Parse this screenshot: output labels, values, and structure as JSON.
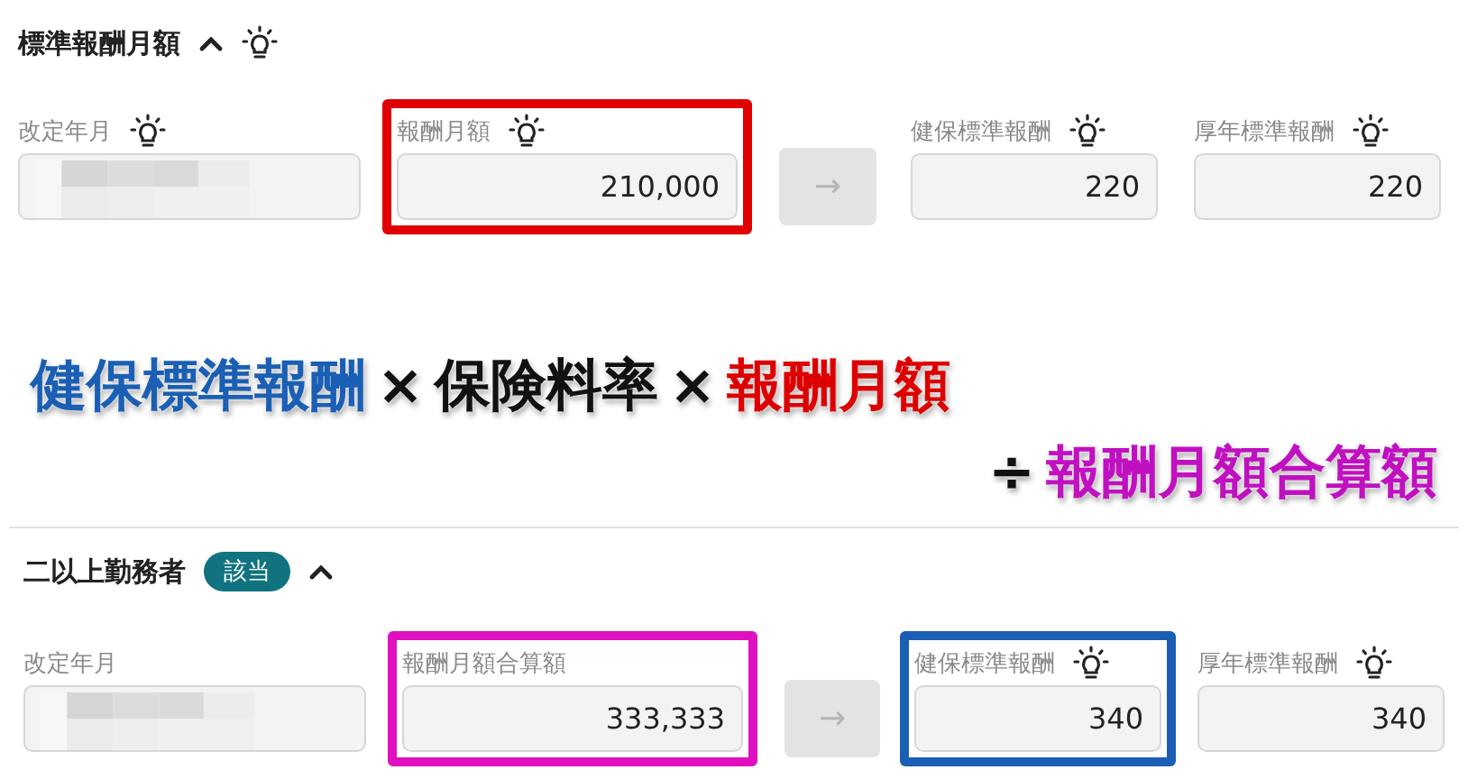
{
  "sections": [
    {
      "title": "標準報酬月額",
      "expanded": true,
      "hint": true,
      "convert_button": "→",
      "fields": [
        {
          "kind": "redacted",
          "label": "改定年月",
          "hint": true
        },
        {
          "kind": "value",
          "label": "報酬月額",
          "hint": true,
          "value": "210,000",
          "color": "#e00000"
        },
        {
          "kind": "value",
          "label": "健保標準報酬",
          "hint": true,
          "value": "220"
        },
        {
          "kind": "value",
          "label": "厚年標準報酬",
          "hint": true,
          "value": "220"
        }
      ]
    },
    {
      "title": "二以上勤務者",
      "badge": "該当",
      "expanded": true,
      "hint": false,
      "convert_button": "→",
      "fields": [
        {
          "kind": "redacted",
          "label": "改定年月",
          "hint": false
        },
        {
          "kind": "value",
          "label": "報酬月額合算額",
          "hint": false,
          "value": "333,333",
          "color": "#e010c0"
        },
        {
          "kind": "value",
          "label": "健保標準報酬",
          "hint": true,
          "value": "340",
          "color": "#1a5fb4"
        },
        {
          "kind": "value",
          "label": "厚年標準報酬",
          "hint": true,
          "value": "340"
        }
      ]
    }
  ],
  "formula": {
    "lines": [
      {
        "parts": [
          {
            "text": "健保標準報酬",
            "color": "#1a5fb4"
          },
          {
            "text": "×",
            "color": "#111111"
          },
          {
            "text": "保険料率",
            "color": "#111111"
          },
          {
            "text": "×",
            "color": "#111111"
          },
          {
            "text": "報酬月額",
            "color": "#dd0000"
          }
        ]
      },
      {
        "parts": [
          {
            "text": "÷",
            "color": "#111111"
          },
          {
            "text": "報酬月額合算額",
            "color": "#c010c0"
          }
        ]
      }
    ]
  }
}
